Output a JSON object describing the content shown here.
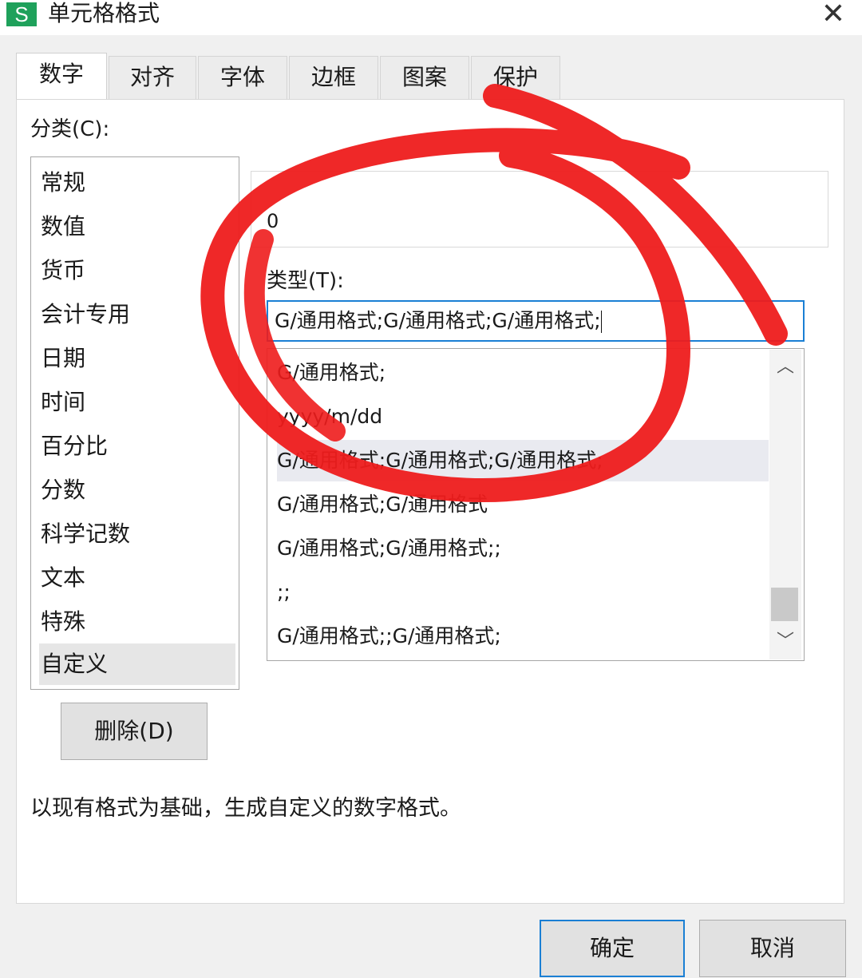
{
  "window": {
    "app_icon_letter": "S",
    "title": "单元格格式",
    "close_glyph": "✕"
  },
  "tabs": [
    {
      "label": "数字",
      "active": true
    },
    {
      "label": "对齐",
      "active": false
    },
    {
      "label": "字体",
      "active": false
    },
    {
      "label": "边框",
      "active": false
    },
    {
      "label": "图案",
      "active": false
    },
    {
      "label": "保护",
      "active": false
    }
  ],
  "category": {
    "label": "分类(C):",
    "items": [
      "常规",
      "数值",
      "货币",
      "会计专用",
      "日期",
      "时间",
      "百分比",
      "分数",
      "科学记数",
      "文本",
      "特殊",
      "自定义"
    ],
    "selected": "自定义"
  },
  "sample": {
    "value": "0"
  },
  "type": {
    "label": "类型(T):",
    "input_value": "G/通用格式;G/通用格式;G/通用格式;",
    "options": [
      "G/通用格式;",
      "yyyy/m/dd",
      "G/通用格式;G/通用格式;G/通用格式;",
      "G/通用格式;G/通用格式",
      "G/通用格式;G/通用格式;;",
      ";;",
      "G/通用格式;;G/通用格式;"
    ],
    "selected_option": "G/通用格式;G/通用格式;G/通用格式;",
    "scroll_up_glyph": "︿",
    "scroll_down_glyph": "﹀"
  },
  "buttons": {
    "delete": "删除(D)",
    "ok": "确定",
    "cancel": "取消"
  },
  "description": "以现有格式为基础，生成自定义的数字格式。",
  "colors": {
    "app_icon": "#1fa15b",
    "focus_border": "#1a7fd4",
    "annotation_red": "#ee1c1c"
  }
}
